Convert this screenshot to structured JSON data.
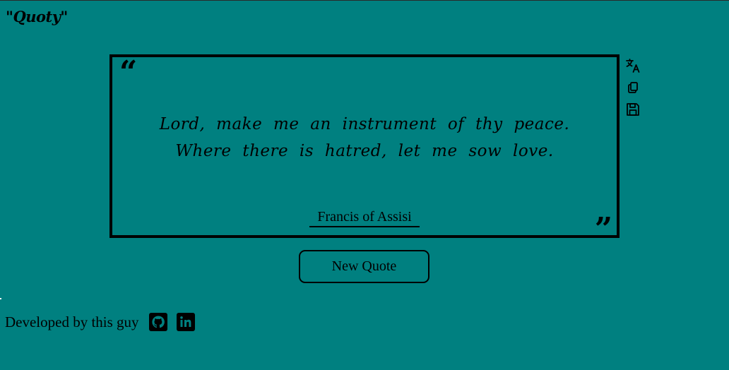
{
  "app": {
    "logo": "\"Quoty\""
  },
  "quote": {
    "open_mark": "“",
    "text": "Lord, make me an instrument of thy peace. Where there is hatred, let me sow love.",
    "author": "Francis of Assisi",
    "close_mark": "”"
  },
  "tools": [
    {
      "icon": "translate-icon"
    },
    {
      "icon": "copy-icon"
    },
    {
      "icon": "save-icon"
    }
  ],
  "actions": {
    "new_quote_label": "New Quote"
  },
  "footer": {
    "text": "Developed by this guy",
    "links": [
      {
        "icon": "github-icon"
      },
      {
        "icon": "linkedin-icon"
      }
    ]
  },
  "colors": {
    "background": "#008080",
    "foreground": "#000000"
  }
}
